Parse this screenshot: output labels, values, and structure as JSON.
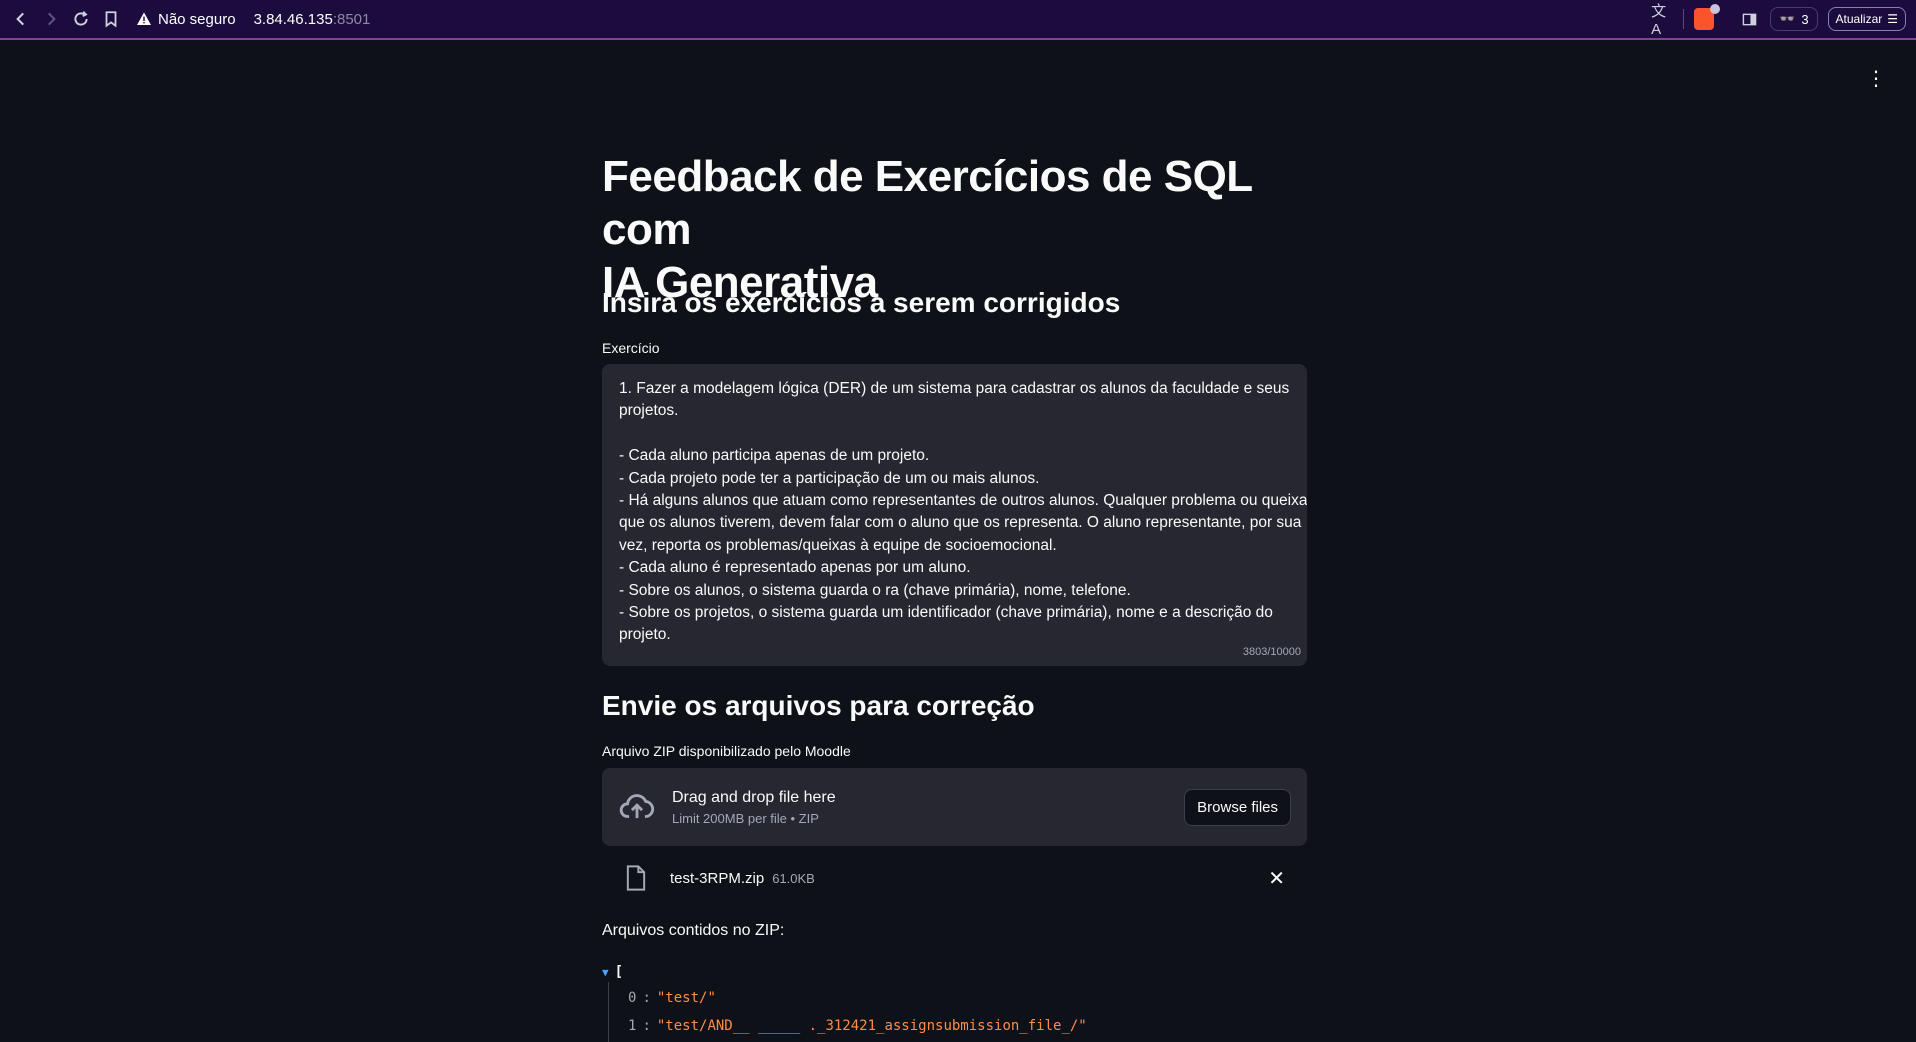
{
  "browser": {
    "security_label": "Não seguro",
    "host": "3.84.46.135",
    "port": ":8501",
    "glasses_count": "3",
    "update_label": "Atualizar"
  },
  "page": {
    "title_line1": "Feedback de Exercícios de SQL com",
    "title_line2": "IA Generativa",
    "exercise_heading": "Insira os exercícios a serem corrigidos",
    "exercise_label": "Exercício",
    "exercise_lines": [
      "1. Fazer a modelagem lógica (DER) de um sistema para cadastrar os alunos da faculdade e seus",
      "projetos.",
      "",
      "- Cada aluno participa apenas de um projeto.",
      "- Cada projeto pode ter a participação de um ou mais alunos.",
      "- Há alguns alunos que atuam como representantes de outros alunos. Qualquer problema ou queixa",
      "que os alunos tiverem, devem falar com o aluno que os representa. O aluno representante, por sua",
      "vez, reporta os problemas/queixas à equipe de socioemocional.",
      "- Cada aluno é representado apenas por um aluno.",
      "- Sobre os alunos, o sistema guarda o ra (chave primária), nome, telefone.",
      "- Sobre os projetos, o sistema guarda um identificador (chave primária), nome e a descrição do",
      "projeto."
    ],
    "char_counter": "3803/10000",
    "upload_heading": "Envie os arquivos para correção",
    "upload_label": "Arquivo ZIP disponibilizado pelo Moodle",
    "dropzone_title": "Drag and drop file here",
    "dropzone_limit": "Limit 200MB per file • ZIP",
    "browse_label": "Browse files",
    "file_name": "test-3RPM.zip",
    "file_size": "61.0KB",
    "zip_contents_label": "Arquivos contidos no ZIP:",
    "json_open": "[",
    "json_items": [
      {
        "index": "0",
        "value": "\"test/\""
      },
      {
        "index": "1",
        "value": "\"test/AND__ _____ ._312421_assignsubmission_file_/\""
      }
    ]
  }
}
